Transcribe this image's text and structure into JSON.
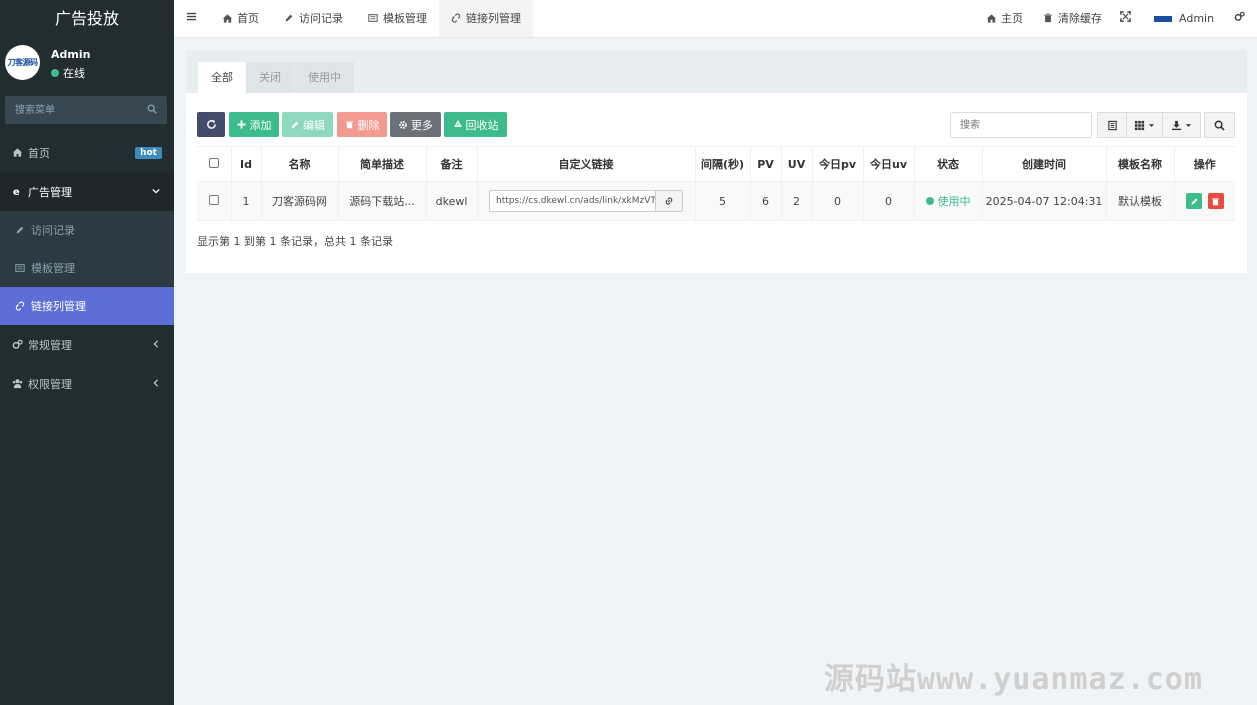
{
  "sidebar": {
    "brand": "广告投放",
    "avatar_text": "刀客源码",
    "user_name": "Admin",
    "user_status": "在线",
    "search_placeholder": "搜索菜单",
    "items": {
      "home": "首页",
      "home_badge": "hot",
      "ad_mgmt": "广告管理",
      "visit_log": "访问记录",
      "template_mgmt": "模板管理",
      "link_mgmt": "链接列管理",
      "general_mgmt": "常规管理",
      "perm_mgmt": "权限管理"
    }
  },
  "topbar": {
    "tabs": [
      "首页",
      "访问记录",
      "模板管理",
      "链接列管理"
    ],
    "main_page": "主页",
    "clear_cache": "清除缓存",
    "admin": "Admin"
  },
  "panel": {
    "filter_tabs": [
      "全部",
      "关闭",
      "使用中"
    ],
    "buttons": {
      "add": "添加",
      "edit": "编辑",
      "delete": "删除",
      "more": "更多",
      "recycle": "回收站"
    },
    "search_placeholder": "搜索",
    "columns": [
      "Id",
      "名称",
      "简单描述",
      "备注",
      "自定义链接",
      "间隔(秒)",
      "PV",
      "UV",
      "今日pv",
      "今日uv",
      "状态",
      "创建时间",
      "模板名称",
      "操作"
    ],
    "rows": [
      {
        "id": "1",
        "name": "刀客源码网",
        "desc": "源码下载站...",
        "remark": "dkewl",
        "link": "https://cs.dkewl.cn/ads/link/xkMzVTy",
        "interval": "5",
        "pv": "6",
        "uv": "2",
        "today_pv": "0",
        "today_uv": "0",
        "status": "使用中",
        "created": "2025-04-07 12:04:31",
        "template": "默认模板"
      }
    ],
    "pagination_info": "显示第 1 到第 1 条记录，总共 1 条记录"
  },
  "watermark": "源码站www.yuanmaz.com",
  "colors": {
    "sidebar_bg": "#222d32",
    "active_menu": "#5b6fd6",
    "success": "#3cbc8d",
    "danger": "#e74c3c",
    "primary_dark": "#444c6e"
  }
}
